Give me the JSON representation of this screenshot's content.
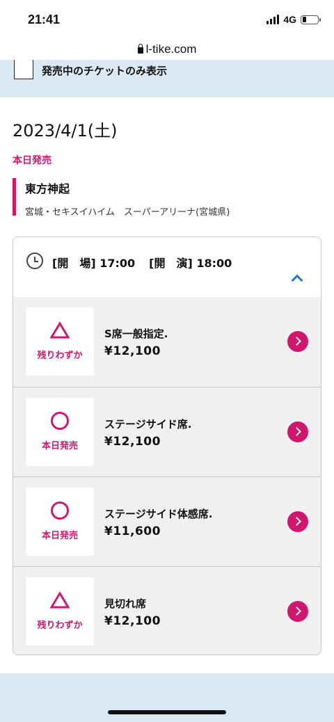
{
  "status_bar": {
    "time": "21:41",
    "network": "4G",
    "battery_level": 0.25
  },
  "browser": {
    "url": "l-tike.com"
  },
  "filter": {
    "label": "発売中のチケットのみ表示",
    "checked": false
  },
  "event": {
    "date": "2023/4/1(土)",
    "sale_status": "本日発売",
    "name": "東方神起",
    "venue": "宮城・セキスイハイム　スーパーアリーナ(宮城県)"
  },
  "performance": {
    "open_label": "[開　場]",
    "open_time": "17:00",
    "start_label": "[開　演]",
    "start_time": "18:00",
    "expanded": true
  },
  "seats": [
    {
      "symbol": "△",
      "status": "残りわずか",
      "name": "S席一般指定.",
      "price": "¥12,100"
    },
    {
      "symbol": "○",
      "status": "本日発売",
      "name": "ステージサイド席.",
      "price": "¥12,100"
    },
    {
      "symbol": "○",
      "status": "本日発売",
      "name": "ステージサイド体感席.",
      "price": "¥11,600"
    },
    {
      "symbol": "△",
      "status": "残りわずか",
      "name": "見切れ席",
      "price": "¥12,100"
    }
  ],
  "colors": {
    "accent": "#d1166d",
    "link": "#1a7fc4",
    "band": "#dbe9f4",
    "row_bg": "#f0f0f0"
  }
}
